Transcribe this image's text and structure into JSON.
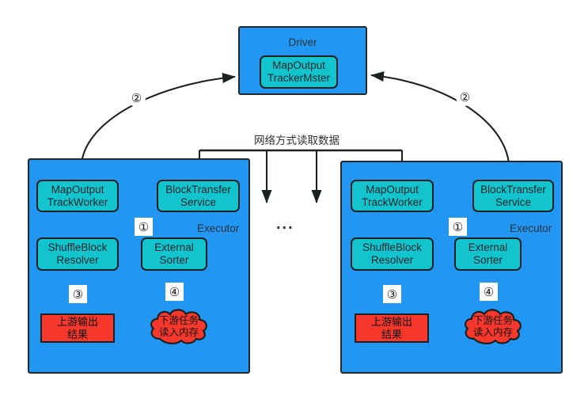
{
  "diagram": {
    "driver": {
      "title": "Driver",
      "inner": {
        "line1": "MapOutput",
        "line2": "TrackerMster"
      }
    },
    "bus": {
      "label": "网络方式读取数据",
      "ellipsis": "..."
    },
    "executors": [
      {
        "name": "Executor",
        "map_output": {
          "line1": "MapOutput",
          "line2": "TrackWorker"
        },
        "block_transfer": {
          "line1": "BlockTransfer",
          "line2": "Service"
        },
        "shuffle_resolver": {
          "line1": "ShuffleBlock",
          "line2": "Resolver"
        },
        "external_sorter": {
          "line1": "External",
          "line2": "Sorter"
        },
        "output_box": {
          "line1": "上游输出",
          "line2": "结果"
        },
        "memory_cloud": {
          "line1": "下游任务",
          "line2": "读入内存"
        },
        "step_one": "①",
        "step_two": "②",
        "step_three": "③",
        "step_four": "④"
      },
      {
        "name": "Executor",
        "map_output": {
          "line1": "MapOutput",
          "line2": "TrackWorker"
        },
        "block_transfer": {
          "line1": "BlockTransfer",
          "line2": "Service"
        },
        "shuffle_resolver": {
          "line1": "ShuffleBlock",
          "line2": "Resolver"
        },
        "external_sorter": {
          "line1": "External",
          "line2": "Sorter"
        },
        "output_box": {
          "line1": "上游输出",
          "line2": "结果"
        },
        "memory_cloud": {
          "line1": "下游任务",
          "line2": "读入内存"
        },
        "step_one": "①",
        "step_two": "②",
        "step_three": "③",
        "step_four": "④"
      }
    ],
    "colors": {
      "panel_blue": "#2196f3",
      "node_teal": "#12c4cd",
      "alert_red": "#f5372c",
      "stroke": "#1b2023",
      "background": "#ffffff"
    }
  }
}
